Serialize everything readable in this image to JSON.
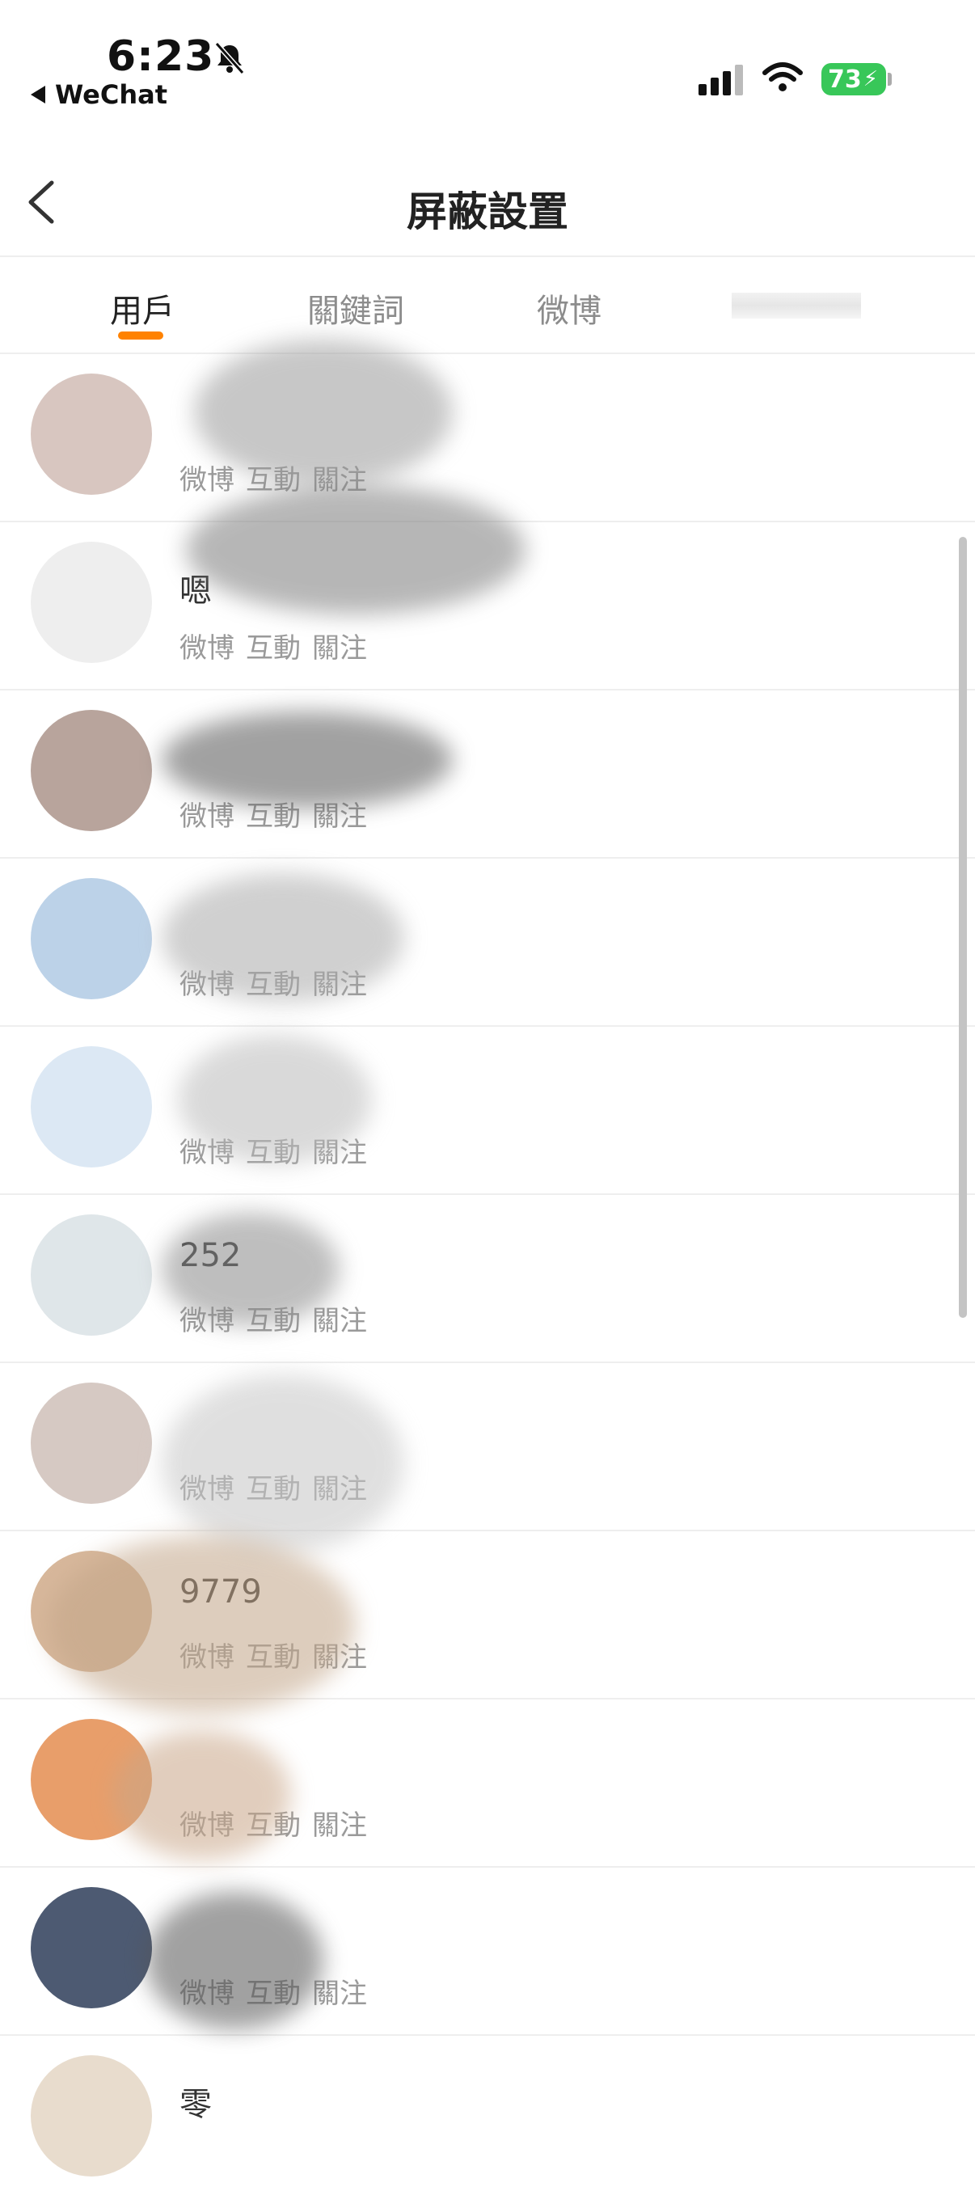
{
  "status_bar": {
    "time": "6:23",
    "back_to_app": "WeChat",
    "battery": "73"
  },
  "nav": {
    "title": "屏蔽設置"
  },
  "tabs": [
    {
      "label": "用戶",
      "active": true
    },
    {
      "label": "關鍵詞",
      "active": false
    },
    {
      "label": "微博",
      "active": false
    }
  ],
  "rows": [
    {
      "name": "",
      "meta": [
        "微博",
        "互動",
        "關注"
      ],
      "avatar": "#d8c6c0"
    },
    {
      "name": "嗯",
      "meta": [
        "微博",
        "互動",
        "關注"
      ],
      "avatar": "#eeeeee"
    },
    {
      "name": "",
      "meta": [
        "微博",
        "互動",
        "關注"
      ],
      "avatar": "#b8a49c"
    },
    {
      "name": "",
      "meta": [
        "微博",
        "互動",
        "關注"
      ],
      "avatar": "#bcd2e8"
    },
    {
      "name": "",
      "meta": [
        "微博",
        "互動",
        "關注"
      ],
      "avatar": "#dce8f4"
    },
    {
      "name": "252",
      "meta": [
        "微博",
        "互動",
        "關注"
      ],
      "avatar": "#dfe6e9"
    },
    {
      "name": "",
      "meta": [
        "微博",
        "互動",
        "關注"
      ],
      "avatar": "#d6c9c3"
    },
    {
      "name": "9779",
      "meta": [
        "微博",
        "互動",
        "關注"
      ],
      "avatar": "#d7b79b"
    },
    {
      "name": "",
      "meta": [
        "微博",
        "互動",
        "關注"
      ],
      "avatar": "#e89e6a"
    },
    {
      "name": "",
      "meta": [
        "微博",
        "互動",
        "關注"
      ],
      "avatar": "#4d5a72"
    },
    {
      "name": "零",
      "meta": [],
      "avatar": "#e8dccd"
    }
  ]
}
